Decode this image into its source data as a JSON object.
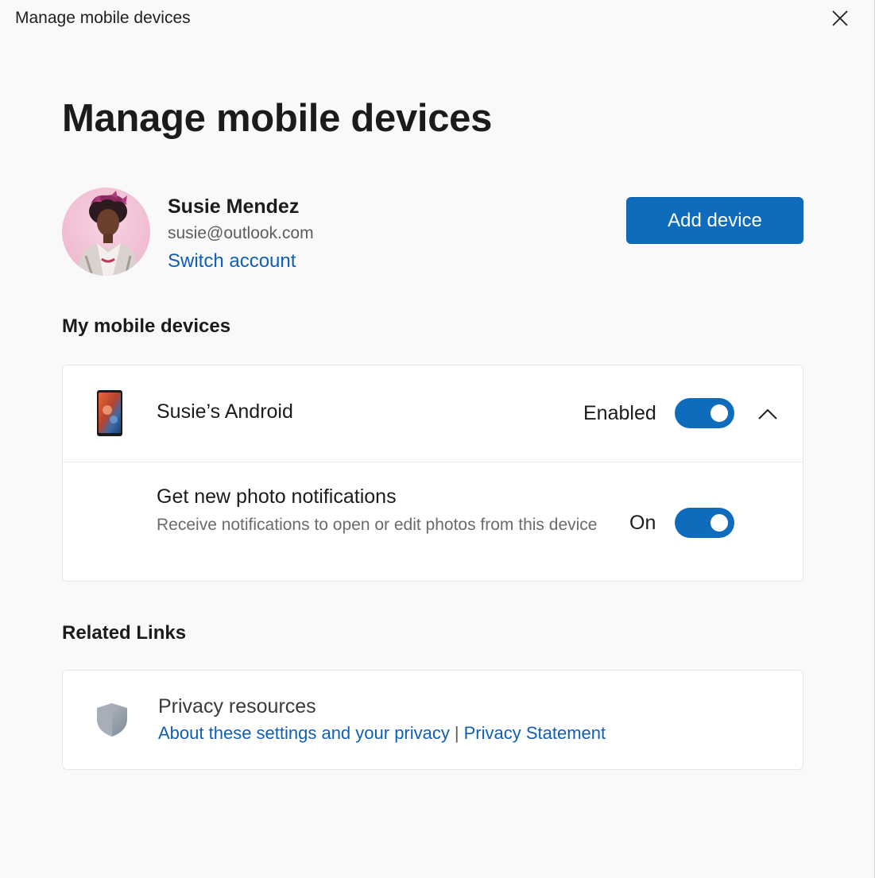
{
  "window": {
    "title": "Manage mobile devices"
  },
  "page": {
    "title": "Manage mobile devices"
  },
  "account": {
    "name": "Susie Mendez",
    "email": "susie@outlook.com",
    "switch_label": "Switch account"
  },
  "add_device_label": "Add device",
  "devices_section": {
    "heading": "My mobile devices",
    "device": {
      "name": "Susie’s Android",
      "status": "Enabled",
      "enabled": true,
      "expanded": true,
      "setting": {
        "title": "Get new photo notifications",
        "description": "Receive notifications to open or edit photos from this device",
        "status": "On",
        "enabled": true
      }
    }
  },
  "related_section": {
    "heading": "Related Links",
    "privacy": {
      "title": "Privacy resources",
      "link1": "About these settings and your privacy",
      "separator": "|",
      "link2": "Privacy Statement"
    }
  },
  "icons": {
    "close": "close-icon",
    "phone": "phone-icon",
    "chevron": "chevron-up-icon",
    "shield": "shield-icon"
  },
  "colors": {
    "accent": "#0f6cbd",
    "link": "#0f5fb8",
    "background": "#f9f9f9"
  }
}
